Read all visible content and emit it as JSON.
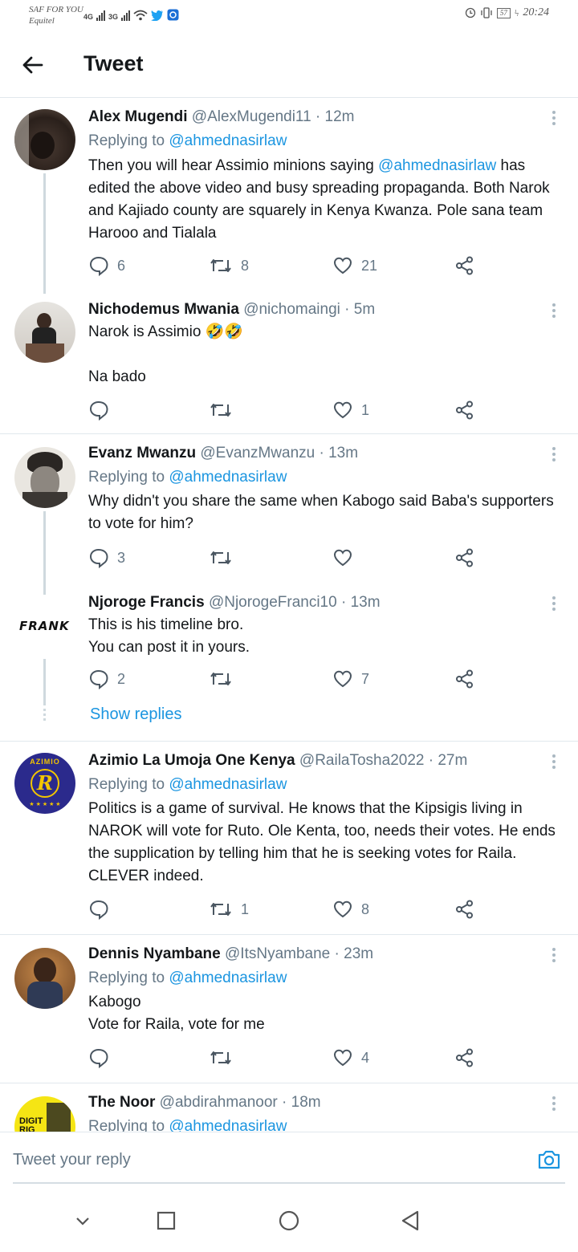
{
  "status_bar": {
    "carrier_line1": "SAF FOR YOU",
    "carrier_line2": "Equitel",
    "net1": "4G",
    "net2": "3G",
    "battery": "57",
    "time": "20:24"
  },
  "header": {
    "title": "Tweet"
  },
  "tweets": [
    {
      "name": "Alex Mugendi",
      "handle": "@AlexMugendi11 · 12m",
      "replying_prefix": "Replying to ",
      "replying_to": "@ahmednasirlaw",
      "body_pre": "Then you will hear Assimio minions saying ",
      "body_mention": "@ahmednasirlaw",
      "body_post": " has edited the above video and busy spreading propaganda. Both Narok and Kajiado county are squarely in Kenya Kwanza. Pole sana team Harooo and Tialala",
      "replies": "6",
      "retweets": "8",
      "likes": "21"
    },
    {
      "name": "Nichodemus Mwania",
      "handle": "@nichomaingi · 5m",
      "body_line1": "Narok is Assimio 🤣🤣",
      "body_line2": "Na bado",
      "replies": "",
      "retweets": "",
      "likes": "1"
    },
    {
      "name": "Evanz Mwanzu",
      "handle": "@EvanzMwanzu · 13m",
      "replying_prefix": "Replying to ",
      "replying_to": "@ahmednasirlaw",
      "body": "Why didn't you share the same when Kabogo said Baba's supporters to vote for him?",
      "replies": "3",
      "retweets": "",
      "likes": ""
    },
    {
      "name": "Njoroge Francis",
      "handle": "@NjorogeFranci10 · 13m",
      "avatar_text": "FRANK",
      "body_line1": "This is his timeline bro.",
      "body_line2": "You can post it in yours.",
      "replies": "2",
      "retweets": "",
      "likes": "7",
      "show_replies": "Show replies"
    },
    {
      "name": "Azimio La Umoja One Kenya",
      "handle": "@RailaTosha2022 · 27m",
      "avatar_text": "AZIMIO",
      "avatar_letter": "R",
      "replying_prefix": "Replying to ",
      "replying_to": "@ahmednasirlaw",
      "body": "Politics is a game of survival. He knows that the Kipsigis living in NAROK will vote for Ruto. Ole Kenta, too, needs their votes. He ends the supplication by telling him that he is seeking votes for Raila. CLEVER indeed.",
      "replies": "",
      "retweets": "1",
      "likes": "8"
    },
    {
      "name": "Dennis Nyambane",
      "handle": "@ItsNyambane · 23m",
      "replying_prefix": "Replying to ",
      "replying_to": "@ahmednasirlaw",
      "body_line1": "Kabogo",
      "body_line2": "Vote for Raila, vote for me",
      "replies": "",
      "retweets": "",
      "likes": "4"
    },
    {
      "name": "The Noor",
      "handle": "@abdirahmanoor · 18m",
      "avatar_text": "DIGIT RIG",
      "replying_prefix": "Replying to ",
      "replying_to": "@ahmednasirlaw"
    }
  ],
  "reply_bar": {
    "placeholder": "Tweet your reply"
  },
  "colors": {
    "accent": "#1b95e0",
    "muted": "#657786",
    "divider": "#e1e8ed"
  },
  "icons": [
    "back-arrow-icon",
    "more-icon",
    "reply-icon",
    "retweet-icon",
    "like-icon",
    "share-icon",
    "camera-icon",
    "nav-back-icon",
    "nav-home-icon",
    "nav-recents-icon",
    "nav-down-icon"
  ]
}
